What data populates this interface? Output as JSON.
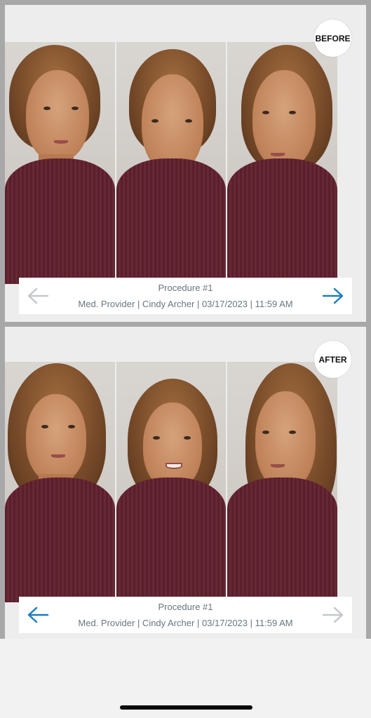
{
  "before": {
    "badge": "BEFORE",
    "procedure": "Procedure #1",
    "meta": "Med. Provider | Cindy Archer | 03/17/2023 | 11:59 AM",
    "left_arrow_color": "#c4c8cc",
    "right_arrow_color": "#1f7dbf"
  },
  "after": {
    "badge": "AFTER",
    "procedure": "Procedure #1",
    "meta": "Med. Provider | Cindy Archer | 03/17/2023 | 11:59 AM",
    "left_arrow_color": "#1f7dbf",
    "right_arrow_color": "#c4c8cc"
  }
}
